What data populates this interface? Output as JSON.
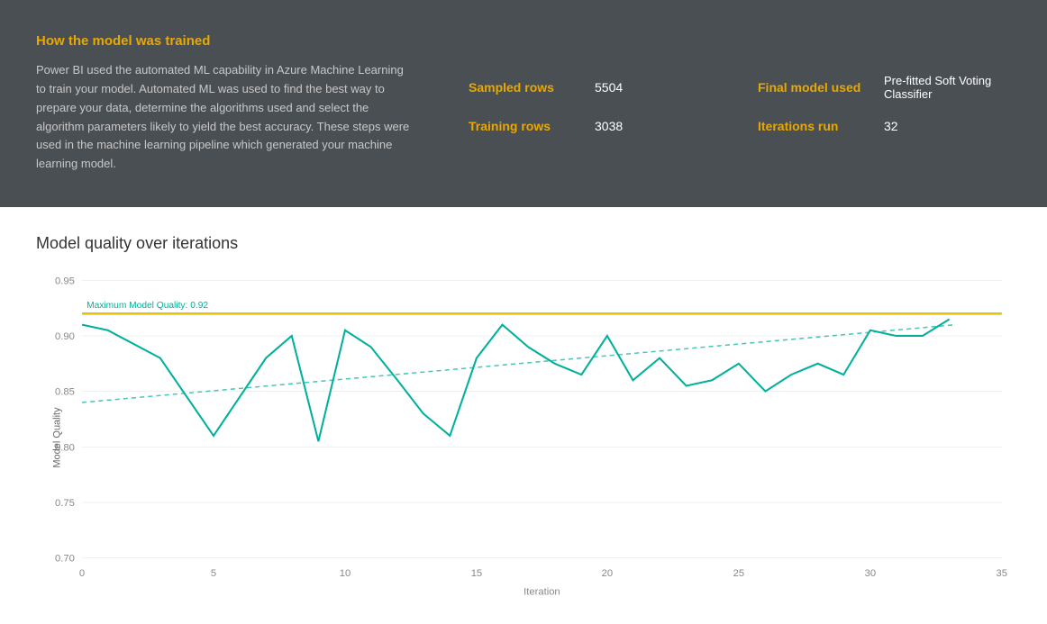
{
  "header": {
    "title": "How the model was trained",
    "description": "Power BI used the automated ML capability in Azure Machine Learning to train your model. Automated ML was used to find the best way to prepare your data, determine the algorithms used and select the algorithm parameters likely to yield the best accuracy. These steps were used in the machine learning pipeline which generated your machine learning model.",
    "stats": [
      {
        "label": "Sampled rows",
        "value": "5504"
      },
      {
        "label": "Final model used",
        "value": "Pre-fitted Soft Voting Classifier"
      },
      {
        "label": "Training rows",
        "value": "3038"
      },
      {
        "label": "Iterations run",
        "value": "32"
      }
    ]
  },
  "chart": {
    "title": "Model quality over iterations",
    "y_label": "Model Quality",
    "x_label": "Iteration",
    "max_label": "Maximum Model Quality: 0.92",
    "max_value": 0.92,
    "y_min": 0.7,
    "y_max": 0.95,
    "x_min": 0,
    "x_max": 35,
    "colors": {
      "line": "#00b09b",
      "max_line": "#e8c200",
      "trend": "#00b09b"
    }
  }
}
